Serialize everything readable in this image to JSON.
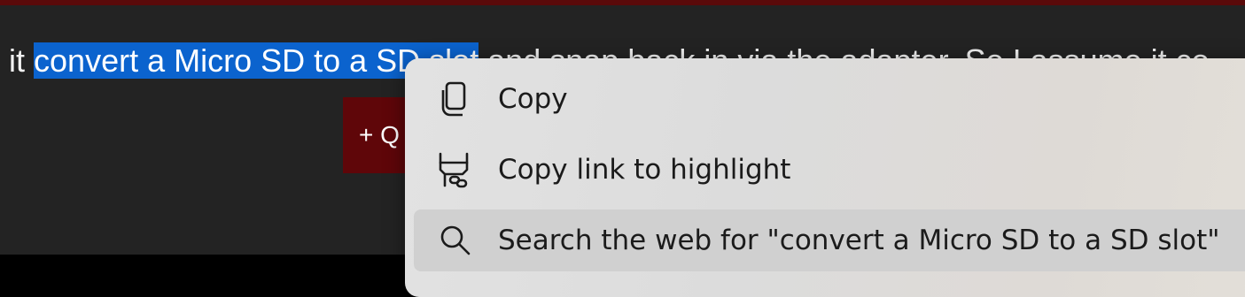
{
  "page": {
    "text_before": "e it ",
    "selected_text": "convert a Micro SD to a SD slot",
    "text_after": " and snap back in via the adapter. So I assume it co",
    "quote_button_label": "+ Q"
  },
  "context_menu": {
    "items": [
      {
        "label": "Copy",
        "icon": "copy-icon"
      },
      {
        "label": "Copy link to highlight",
        "icon": "link-highlight-icon"
      },
      {
        "label": "Search the web for \"convert a Micro SD to a SD slot\"",
        "icon": "search-icon",
        "hovered": true
      }
    ]
  },
  "colors": {
    "selection": "#0b63ce",
    "page_background": "#232323",
    "accent_button": "#5f0609",
    "menu_background": "#e0e0e0",
    "menu_hover": "#d0d0d0"
  }
}
